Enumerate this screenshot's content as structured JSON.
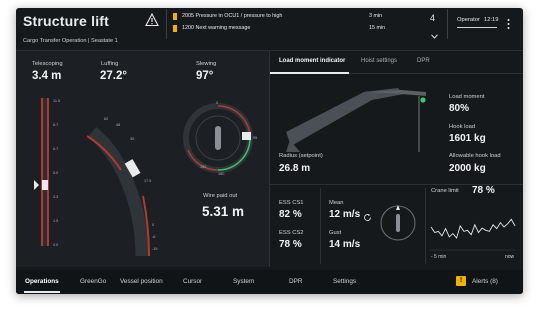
{
  "app": {
    "title": "Structure lift",
    "subtitle": "Cargo Transfer Operation | Seastate 1"
  },
  "alarms": {
    "count": "4",
    "items": [
      {
        "text": "2005 Pressure in OCU1 / pressure to high",
        "time": "3 min"
      },
      {
        "text": "1200 Next warning message",
        "time": "15 min"
      }
    ]
  },
  "header": {
    "operator_label": "Operator",
    "clock": "12:19"
  },
  "telescoping": {
    "label": "Telescoping",
    "value": "3.4 m",
    "scale_ticks": [
      "11.5",
      "8.7",
      "6.7",
      "5.0",
      "3.3",
      "1.5",
      "0.0"
    ]
  },
  "luffing": {
    "label": "Luffing",
    "value": "27.2°",
    "scale_ticks": [
      "62",
      "48",
      "30",
      "17.5",
      "0",
      "-6",
      "-15"
    ]
  },
  "slewing": {
    "label": "Slewing",
    "value": "97°",
    "scale_ticks": [
      "0",
      "95",
      "150",
      "180"
    ]
  },
  "wire": {
    "label": "Wire paid out",
    "value": "5.31 m"
  },
  "tabs": [
    {
      "label": "Load moment indicator",
      "active": true
    },
    {
      "label": "Hoist settings",
      "active": false
    },
    {
      "label": "DPR",
      "active": false
    }
  ],
  "lmi": {
    "radius_label": "Radius (setpoint)",
    "radius_value": "26.8 m",
    "load_moment_label": "Load moment",
    "load_moment_value": "80%",
    "hook_load_label": "Hook load",
    "hook_load_value": "1601 kg",
    "allowable_label": "Allowable hook load",
    "allowable_value": "2000 kg"
  },
  "ess": {
    "cs1_label": "ESS CS1",
    "cs1_value": "82 %",
    "cs2_label": "ESS CS2",
    "cs2_value": "78 %"
  },
  "wind": {
    "mean_label": "Mean",
    "mean_value": "12 m/s",
    "gust_label": "Gust",
    "gust_value": "14 m/s"
  },
  "crane_limit": {
    "label": "Crane limit",
    "value": "78 %",
    "x_start": "- 5 min",
    "x_end": "now",
    "trend": [
      58,
      48,
      50,
      42,
      55,
      40,
      46,
      38,
      60,
      50,
      52,
      44,
      62,
      48,
      56,
      52,
      50,
      62,
      55,
      66,
      58,
      64,
      72,
      60
    ]
  },
  "nav": {
    "items": [
      "Operations",
      "GreenGo",
      "Vessel position",
      "Cursor",
      "System",
      "DPR",
      "Settings"
    ],
    "alerts": "Alerts (8)"
  },
  "colors": {
    "accent_green": "#38c86a",
    "warning_yellow": "#f0b400",
    "alarm_red": "#c0392b"
  }
}
